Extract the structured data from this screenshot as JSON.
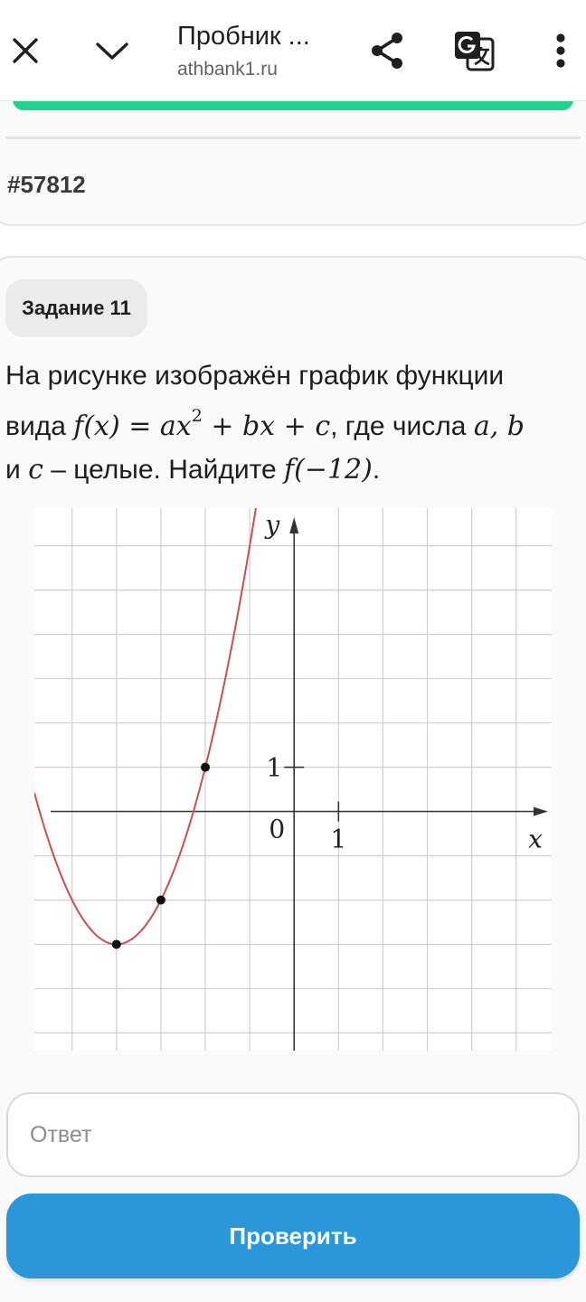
{
  "header": {
    "title": "Пробник ...",
    "url": "athbank1.ru"
  },
  "card": {
    "task_id": "#57812"
  },
  "task": {
    "badge": "Задание 11",
    "problem": {
      "line1": "На рисунке изображён график функции",
      "vida": "вида ",
      "formula": "f(x) = ax",
      "exp": "2",
      "formula_tail": " + bx + c",
      "gde": ", где числа ",
      "a_b": "a, b",
      "i": "и ",
      "c": "c",
      "dash": " – целые. Найдите ",
      "target": "f(−12)",
      "period": "."
    }
  },
  "chart_data": {
    "type": "line",
    "x_label": "x",
    "y_label": "y",
    "origin_label": "0",
    "x_tick_label": "1",
    "y_tick_label": "1",
    "xlim": [
      -5.85,
      5.8
    ],
    "ylim": [
      -5.4,
      6.85
    ],
    "grid": true,
    "function": {
      "a": 1,
      "b": 8,
      "c": 13
    },
    "curve_color": "#c9504e",
    "points": [
      {
        "x": -4,
        "y": -3
      },
      {
        "x": -3,
        "y": -2
      },
      {
        "x": -2,
        "y": 1
      }
    ]
  },
  "answer": {
    "placeholder": "Ответ"
  },
  "check_button": {
    "label": "Проверить"
  }
}
